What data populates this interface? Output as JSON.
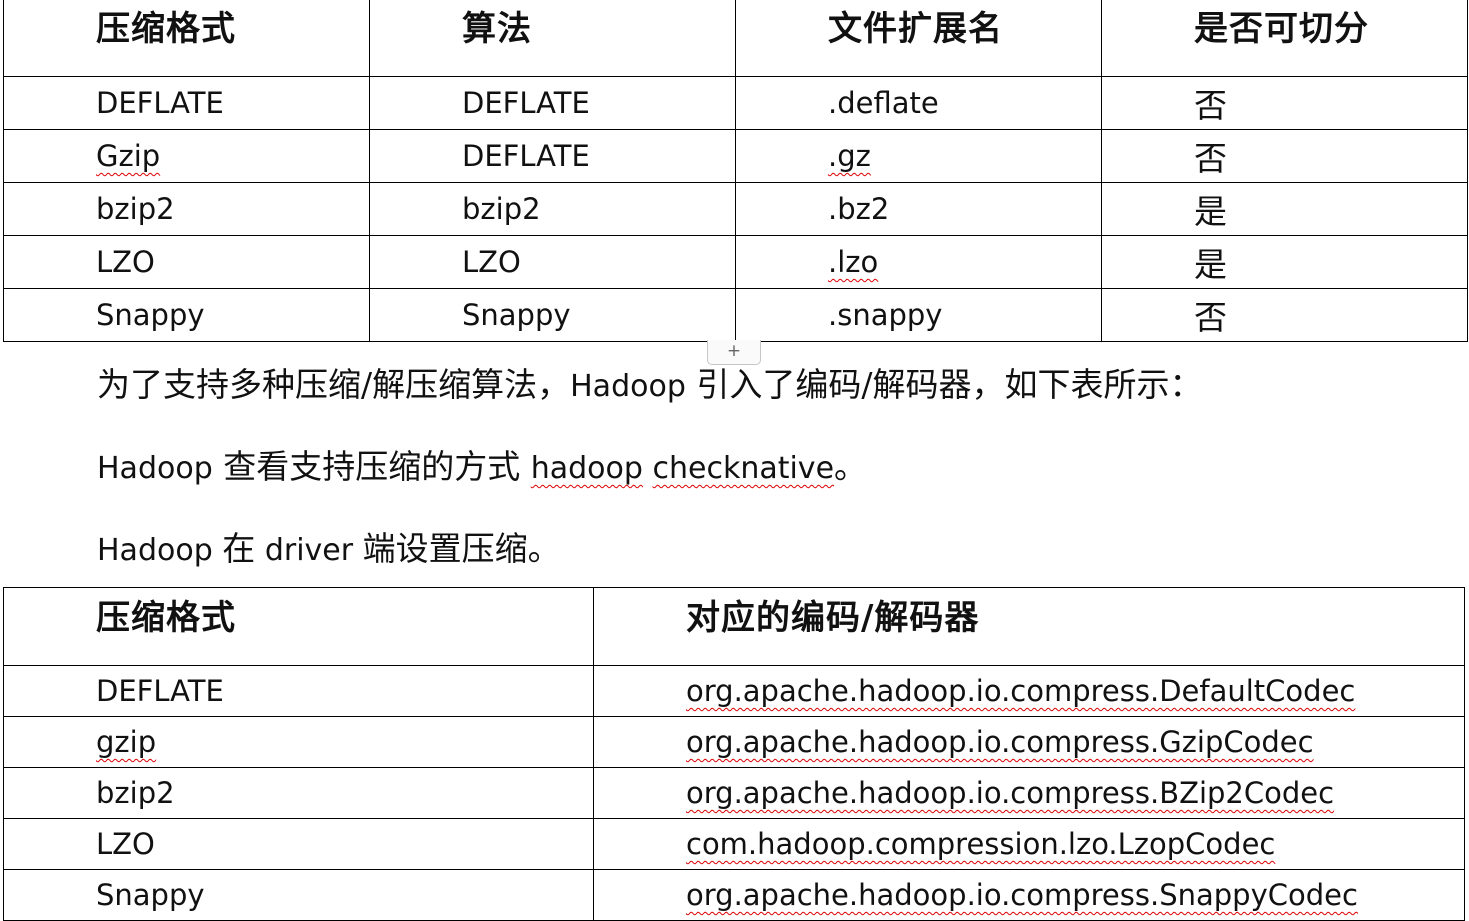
{
  "table1": {
    "headers": [
      "压缩格式",
      "算法",
      "文件扩展名",
      "是否可切分"
    ],
    "rows": [
      [
        "DEFLATE",
        "DEFLATE",
        ".deflate",
        "否"
      ],
      [
        "Gzip",
        "DEFLATE",
        ".gz",
        "否"
      ],
      [
        "bzip2",
        "bzip2",
        ".bz2",
        "是"
      ],
      [
        "LZO",
        "LZO",
        ".lzo",
        "是"
      ],
      [
        "Snappy",
        "Snappy",
        ".snappy",
        "否"
      ]
    ]
  },
  "add_row_handle": "+",
  "paragraphs": {
    "p1": {
      "a": "为了支持多种压缩/解压缩算法，",
      "b": "Hadoop",
      "c": " 引入了编码/解码器，如下表所示："
    },
    "p2": {
      "a": "Hadoop",
      "b": " 查看支持压缩的方式 ",
      "c": "hadoop",
      "d": " ",
      "e": "checknative",
      "f": "。"
    },
    "p3": {
      "a": "Hadoop ",
      "b": "在",
      "c": " driver ",
      "d": "端设置压缩。"
    }
  },
  "table2": {
    "headers": [
      "压缩格式",
      "对应的编码/解码器"
    ],
    "rows": [
      [
        "DEFLATE",
        "org.apache.hadoop.io.compress.DefaultCodec"
      ],
      [
        "gzip",
        "org.apache.hadoop.io.compress.GzipCodec"
      ],
      [
        "bzip2",
        "org.apache.hadoop.io.compress.BZip2Codec"
      ],
      [
        "LZO",
        "com.hadoop.compression.lzo.LzopCodec"
      ],
      [
        "Snappy",
        "org.apache.hadoop.io.compress.SnappyCodec"
      ]
    ]
  }
}
